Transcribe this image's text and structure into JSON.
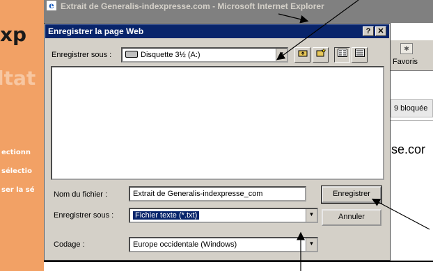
{
  "background": {
    "left_texts": [
      "xp",
      "ltat",
      "ectionn",
      "sélectio",
      "ser la sé"
    ],
    "browser_title": "Extrait de Generalis-indexpresse.com - Microsoft Internet Explorer",
    "favorites_label": "Favoris",
    "blocked_text": "9 bloquée",
    "site_text": "se.cor"
  },
  "dialog": {
    "title": "Enregistrer la page Web",
    "help_label": "?",
    "close_label": "✕",
    "save_in_label": "Enregistrer sous :",
    "save_in_value": "Disquette 3½ (A:)",
    "filename_label": "Nom du fichier :",
    "filename_value": "Extrait de Generalis-indexpresse_com",
    "save_as_label": "Enregistrer sous :",
    "save_as_value": "Fichier texte (*.txt)",
    "encoding_label": "Codage :",
    "encoding_value": "Europe occidentale (Windows)",
    "save_button": "Enregistrer",
    "cancel_button": "Annuler"
  },
  "colors": {
    "titlebar": "#08246b",
    "dialog_bg": "#d4d0c8",
    "left_bg": "#f2a165"
  }
}
